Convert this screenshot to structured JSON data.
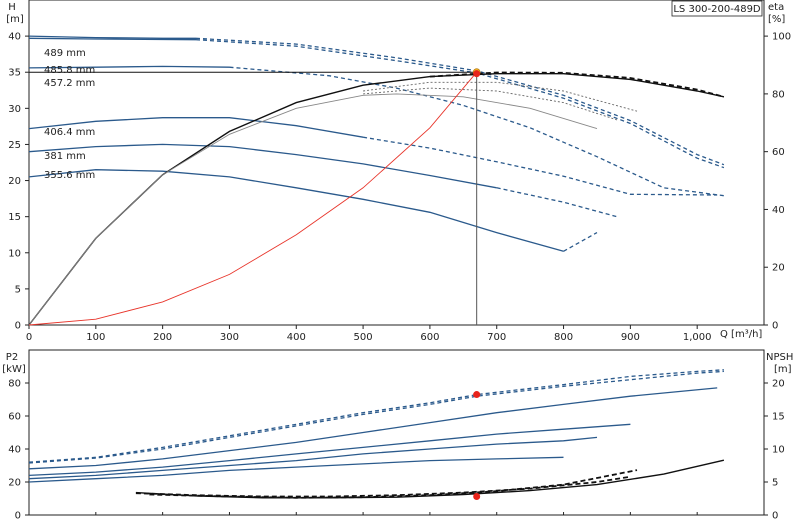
{
  "chart_data": [
    {
      "type": "line",
      "role": "head",
      "model_label": "LS 300-200-489D",
      "y_label_top": "H",
      "y_unit_top": "[m]",
      "eta_label": "eta",
      "eta_unit": "[%]",
      "x_label": "Q [m³/h]",
      "xlim": [
        0,
        1100
      ],
      "ylim": [
        0,
        45
      ],
      "eta_lim": [
        0,
        112.5
      ],
      "x_ticks": [
        "0",
        "100",
        "200",
        "300",
        "400",
        "500",
        "600",
        "700",
        "800",
        "900",
        "1,000"
      ],
      "y_ticks": [
        "0",
        "5",
        "10",
        "15",
        "20",
        "25",
        "30",
        "35",
        "40"
      ],
      "eta_ticks": [
        "0",
        "20",
        "40",
        "60",
        "80",
        "100"
      ],
      "head_curves": [
        {
          "name": "489 mm",
          "solid": [
            [
              0,
              40
            ],
            [
              100,
              39.8
            ],
            [
              200,
              39.7
            ],
            [
              250,
              39.7
            ]
          ],
          "dashed": [
            [
              250,
              39.7
            ],
            [
              400,
              38.9
            ],
            [
              550,
              37
            ],
            [
              670,
              35.2
            ],
            [
              800,
              31.8
            ],
            [
              900,
              28.3
            ],
            [
              1000,
              23.6
            ],
            [
              1040,
              22.2
            ]
          ]
        },
        {
          "name": "485.8 mm",
          "solid": [
            [
              0,
              39.7
            ],
            [
              100,
              39.6
            ],
            [
              250,
              39.5
            ]
          ],
          "dashed": [
            [
              250,
              39.5
            ],
            [
              400,
              38.6
            ],
            [
              550,
              36.6
            ],
            [
              670,
              34.9
            ],
            [
              800,
              31.4
            ],
            [
              900,
              27.9
            ],
            [
              1000,
              23.1
            ],
            [
              1040,
              21.8
            ]
          ]
        },
        {
          "name": "457.2 mm",
          "solid": [
            [
              0,
              35.6
            ],
            [
              100,
              35.7
            ],
            [
              200,
              35.8
            ],
            [
              300,
              35.7
            ]
          ],
          "dashed": [
            [
              300,
              35.7
            ],
            [
              450,
              34.5
            ],
            [
              550,
              32.8
            ],
            [
              650,
              30.4
            ],
            [
              750,
              27.3
            ],
            [
              850,
              23.3
            ],
            [
              950,
              19
            ],
            [
              1040,
              17.9
            ]
          ]
        },
        {
          "name": "406.4 mm",
          "solid": [
            [
              0,
              27.2
            ],
            [
              100,
              28.2
            ],
            [
              200,
              28.7
            ],
            [
              300,
              28.7
            ],
            [
              400,
              27.6
            ],
            [
              500,
              26
            ]
          ],
          "dashed": [
            [
              500,
              26
            ],
            [
              600,
              24.5
            ],
            [
              700,
              22.6
            ],
            [
              800,
              20.6
            ],
            [
              900,
              18.1
            ],
            [
              1030,
              18
            ]
          ]
        },
        {
          "name": "381 mm",
          "solid": [
            [
              0,
              24
            ],
            [
              100,
              24.7
            ],
            [
              200,
              25
            ],
            [
              300,
              24.7
            ],
            [
              400,
              23.6
            ],
            [
              500,
              22.3
            ],
            [
              600,
              20.7
            ],
            [
              700,
              19
            ]
          ],
          "dashed": [
            [
              700,
              19
            ],
            [
              800,
              17
            ],
            [
              880,
              15
            ]
          ]
        },
        {
          "name": "355.6 mm",
          "solid": [
            [
              0,
              20.5
            ],
            [
              100,
              21.5
            ],
            [
              200,
              21.3
            ],
            [
              300,
              20.5
            ],
            [
              400,
              19
            ],
            [
              500,
              17.4
            ],
            [
              600,
              15.6
            ],
            [
              700,
              12.8
            ],
            [
              800,
              10.2
            ]
          ],
          "dashed": [
            [
              800,
              10.2
            ],
            [
              850,
              12.8
            ]
          ]
        }
      ],
      "system_curve": [
        [
          0,
          0
        ],
        [
          100,
          0.8
        ],
        [
          200,
          3.2
        ],
        [
          300,
          7
        ],
        [
          400,
          12.5
        ],
        [
          500,
          19
        ],
        [
          600,
          27.3
        ],
        [
          670,
          35
        ]
      ],
      "duty_point": {
        "q": 670,
        "h": 35
      },
      "eta_curves": [
        {
          "name": "489 mm",
          "points": [
            [
              0,
              0
            ],
            [
              100,
              30
            ],
            [
              200,
              52
            ],
            [
              300,
              67
            ],
            [
              400,
              77
            ],
            [
              500,
              83
            ],
            [
              600,
              86
            ],
            [
              700,
              87
            ],
            [
              800,
              87
            ],
            [
              900,
              85
            ],
            [
              1000,
              81
            ],
            [
              1040,
              79
            ]
          ]
        },
        {
          "name": "355.6 mm",
          "points": [
            [
              0,
              0
            ],
            [
              100,
              30
            ],
            [
              200,
              52
            ],
            [
              300,
              66
            ],
            [
              400,
              75
            ],
            [
              500,
              79.5
            ],
            [
              550,
              80
            ],
            [
              650,
              79
            ],
            [
              750,
              75
            ],
            [
              850,
              68
            ]
          ]
        }
      ],
      "eta_duty": {
        "q": 670,
        "eta": 87
      }
    },
    {
      "type": "line",
      "role": "power-npsh",
      "y_label_top": "P2",
      "y_unit_top": "[kW]",
      "npsh_label": "NPSH",
      "npsh_unit": "[m]",
      "xlim": [
        0,
        1100
      ],
      "p2_lim": [
        0,
        100
      ],
      "npsh_lim": [
        0,
        25
      ],
      "p2_ticks": [
        "0",
        "20",
        "40",
        "60",
        "80"
      ],
      "npsh_ticks": [
        "0",
        "5",
        "10",
        "15",
        "20"
      ],
      "power_curves": [
        {
          "name": "489 mm",
          "points": [
            [
              0,
              32
            ],
            [
              100,
              35
            ],
            [
              200,
              41
            ],
            [
              300,
              48
            ],
            [
              400,
              55
            ],
            [
              500,
              62
            ],
            [
              600,
              68
            ],
            [
              670,
              73
            ],
            [
              800,
              79
            ],
            [
              900,
              84
            ],
            [
              1000,
              87
            ],
            [
              1040,
              88
            ]
          ]
        },
        {
          "name": "485.8 mm",
          "points": [
            [
              0,
              31.5
            ],
            [
              100,
              34.5
            ],
            [
              200,
              40
            ],
            [
              300,
              47
            ],
            [
              400,
              54
            ],
            [
              500,
              61
            ],
            [
              600,
              67
            ],
            [
              670,
              72
            ],
            [
              800,
              78
            ],
            [
              900,
              82
            ],
            [
              1000,
              86
            ],
            [
              1040,
              87
            ]
          ]
        },
        {
          "name": "457.2 mm",
          "points": [
            [
              0,
              28
            ],
            [
              100,
              30
            ],
            [
              200,
              34
            ],
            [
              300,
              39
            ],
            [
              400,
              44
            ],
            [
              500,
              50
            ],
            [
              600,
              56
            ],
            [
              700,
              62
            ],
            [
              800,
              67
            ],
            [
              900,
              72
            ],
            [
              1030,
              77
            ]
          ]
        },
        {
          "name": "406.4 mm",
          "points": [
            [
              0,
              24
            ],
            [
              100,
              26
            ],
            [
              200,
              29
            ],
            [
              300,
              33
            ],
            [
              400,
              37
            ],
            [
              500,
              41
            ],
            [
              600,
              45
            ],
            [
              700,
              49
            ],
            [
              800,
              52
            ],
            [
              900,
              55
            ]
          ]
        },
        {
          "name": "381 mm",
          "points": [
            [
              0,
              22
            ],
            [
              100,
              24
            ],
            [
              200,
              27
            ],
            [
              300,
              30
            ],
            [
              400,
              33
            ],
            [
              500,
              37
            ],
            [
              600,
              40
            ],
            [
              700,
              43
            ],
            [
              800,
              45
            ],
            [
              850,
              47
            ]
          ]
        },
        {
          "name": "355.6 mm",
          "points": [
            [
              0,
              20
            ],
            [
              100,
              22
            ],
            [
              200,
              24
            ],
            [
              300,
              27
            ],
            [
              400,
              29
            ],
            [
              500,
              31
            ],
            [
              600,
              33
            ],
            [
              700,
              34
            ],
            [
              800,
              35
            ]
          ]
        }
      ],
      "p2_duty": {
        "q": 670,
        "p2": 73
      },
      "npsh_curves": [
        {
          "name": "489 mm",
          "points": [
            [
              160,
              3.4
            ],
            [
              250,
              2.9
            ],
            [
              350,
              2.6
            ],
            [
              450,
              2.6
            ],
            [
              550,
              2.7
            ],
            [
              650,
              3.1
            ],
            [
              750,
              3.7
            ],
            [
              850,
              4.6
            ],
            [
              950,
              6.2
            ],
            [
              1040,
              8.3
            ]
          ]
        },
        {
          "name": "406.4 mm",
          "points": [
            [
              180,
              3.1
            ],
            [
              300,
              2.8
            ],
            [
              400,
              2.6
            ],
            [
              500,
              2.7
            ],
            [
              600,
              3.0
            ],
            [
              700,
              3.6
            ],
            [
              800,
              4.6
            ],
            [
              850,
              5.6
            ],
            [
              910,
              6.8
            ]
          ]
        },
        {
          "name": "355.6 mm",
          "points": [
            [
              160,
              3.3
            ],
            [
              250,
              3.0
            ],
            [
              350,
              2.8
            ],
            [
              450,
              2.8
            ],
            [
              550,
              3.0
            ],
            [
              650,
              3.4
            ],
            [
              750,
              4.0
            ],
            [
              850,
              5.0
            ],
            [
              900,
              5.8
            ]
          ]
        }
      ],
      "npsh_duty": {
        "q": 670,
        "npsh": 2.8
      }
    }
  ]
}
